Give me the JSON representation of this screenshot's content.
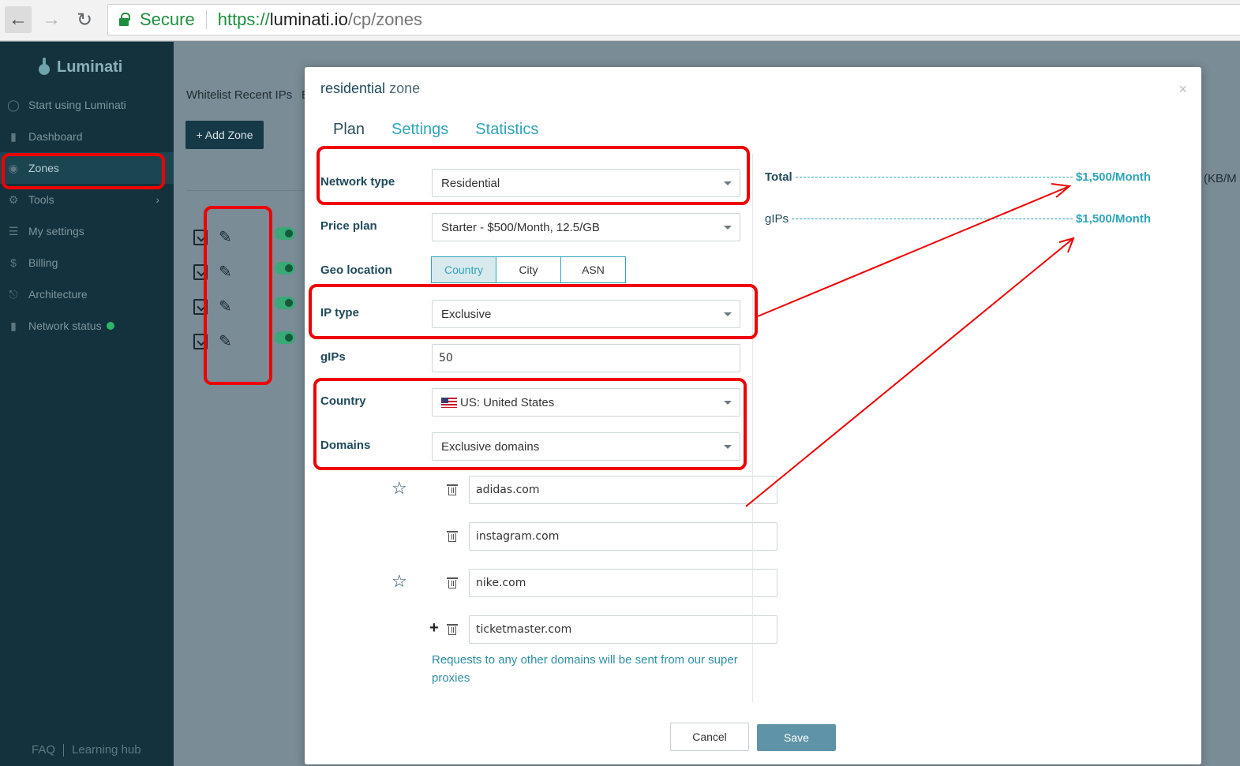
{
  "browser": {
    "secure_label": "Secure",
    "url_protocol": "https://",
    "url_host": "luminati.io",
    "url_path": "/cp/zones"
  },
  "sidebar": {
    "brand": "Luminati",
    "items": [
      {
        "label": "Start using Luminati",
        "icon": "bulb-icon"
      },
      {
        "label": "Dashboard",
        "icon": "bar-chart-icon"
      },
      {
        "label": "Zones",
        "icon": "map-pin-icon"
      },
      {
        "label": "Tools",
        "icon": "gear-icon"
      },
      {
        "label": "My settings",
        "icon": "sliders-icon"
      },
      {
        "label": "Billing",
        "icon": "dollar-icon"
      },
      {
        "label": "Architecture",
        "icon": "network-icon"
      },
      {
        "label": "Network status",
        "icon": "bar-chart-icon"
      }
    ],
    "active": "Zones",
    "footer": {
      "faq": "FAQ",
      "learning": "Learning hub"
    }
  },
  "background": {
    "whitelist_link": "Whitelist Recent IPs",
    "cut_letter": "E",
    "add_zone_label": "+ Add Zone",
    "kb_label": "(KB/M"
  },
  "modal": {
    "title_name": "residential",
    "title_suffix": "zone",
    "close": "×",
    "tabs": [
      "Plan",
      "Settings",
      "Statistics"
    ],
    "active_tab": "Plan",
    "fields": {
      "network_type": {
        "label": "Network type",
        "value": "Residential"
      },
      "price_plan": {
        "label": "Price plan",
        "value": "Starter - $500/Month, 12.5/GB"
      },
      "geo_location": {
        "label": "Geo location",
        "options": [
          "Country",
          "City",
          "ASN"
        ],
        "selected": "Country"
      },
      "ip_type": {
        "label": "IP type",
        "value": "Exclusive"
      },
      "gips": {
        "label": "gIPs",
        "value": "50"
      },
      "country": {
        "label": "Country",
        "value": "US: United States"
      },
      "domains": {
        "label": "Domains",
        "value": "Exclusive domains"
      }
    },
    "domain_list": [
      "adidas.com",
      "instagram.com",
      "nike.com",
      "ticketmaster.com"
    ],
    "note": "Requests to any other domains will be sent from our super proxies",
    "summary": [
      {
        "label": "Total",
        "value": "$1,500/Month"
      },
      {
        "label": "gIPs",
        "value": "$1,500/Month"
      }
    ],
    "buttons": {
      "cancel": "Cancel",
      "save": "Save"
    }
  },
  "colors": {
    "accent": "#2fa5b8",
    "sidebar_bg": "#14323d",
    "annotation": "#e00000",
    "save_button": "#5f94a8"
  }
}
